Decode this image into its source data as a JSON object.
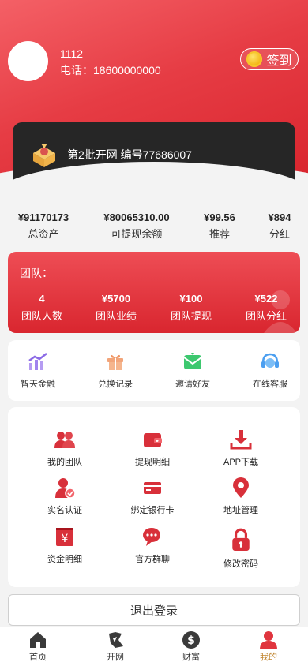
{
  "user": {
    "id": "1112",
    "phone": "电话：18600000000",
    "signin_label": "签到"
  },
  "membership": {
    "text": "第2批开网 编号77686007"
  },
  "stats": [
    {
      "value": "¥91170173",
      "label": "总资产"
    },
    {
      "value": "¥80065310.00",
      "label": "可提现余额"
    },
    {
      "value": "¥99.56",
      "label": "推荐"
    },
    {
      "value": "¥894",
      "label": "分红"
    }
  ],
  "team": {
    "title": "团队：",
    "items": [
      {
        "value": "4",
        "label": "团队人数"
      },
      {
        "value": "¥5700",
        "label": "团队业绩"
      },
      {
        "value": "¥100",
        "label": "团队提现"
      },
      {
        "value": "¥522",
        "label": "团队分红"
      }
    ]
  },
  "quick": [
    {
      "label": "智天金融",
      "icon": "chart-trend-icon"
    },
    {
      "label": "兑换记录",
      "icon": "gift-icon"
    },
    {
      "label": "邀请好友",
      "icon": "invite-envelope-icon"
    },
    {
      "label": "在线客服",
      "icon": "headset-icon"
    }
  ],
  "grid": [
    {
      "label": "我的团队",
      "icon": "team-icon"
    },
    {
      "label": "提现明细",
      "icon": "wallet-icon"
    },
    {
      "label": "APP下载",
      "icon": "download-icon"
    },
    {
      "label": "实名认证",
      "icon": "verified-user-icon"
    },
    {
      "label": "绑定银行卡",
      "icon": "bank-card-icon"
    },
    {
      "label": "地址管理",
      "icon": "location-pin-icon"
    },
    {
      "label": "资金明细",
      "icon": "yuan-ledger-icon"
    },
    {
      "label": "官方群聊",
      "icon": "chat-bubble-icon"
    },
    {
      "label": "修改密码",
      "icon": "lock-icon"
    }
  ],
  "logout_label": "退出登录",
  "tabs": [
    {
      "label": "首页",
      "icon": "home-icon"
    },
    {
      "label": "开网",
      "icon": "network-icon"
    },
    {
      "label": "财富",
      "icon": "dollar-icon"
    },
    {
      "label": "我的",
      "icon": "profile-icon",
      "active": true
    }
  ],
  "colors": {
    "brand_red": "#e63c44",
    "dark_card": "#262626",
    "active_tab": "#c1852f"
  }
}
